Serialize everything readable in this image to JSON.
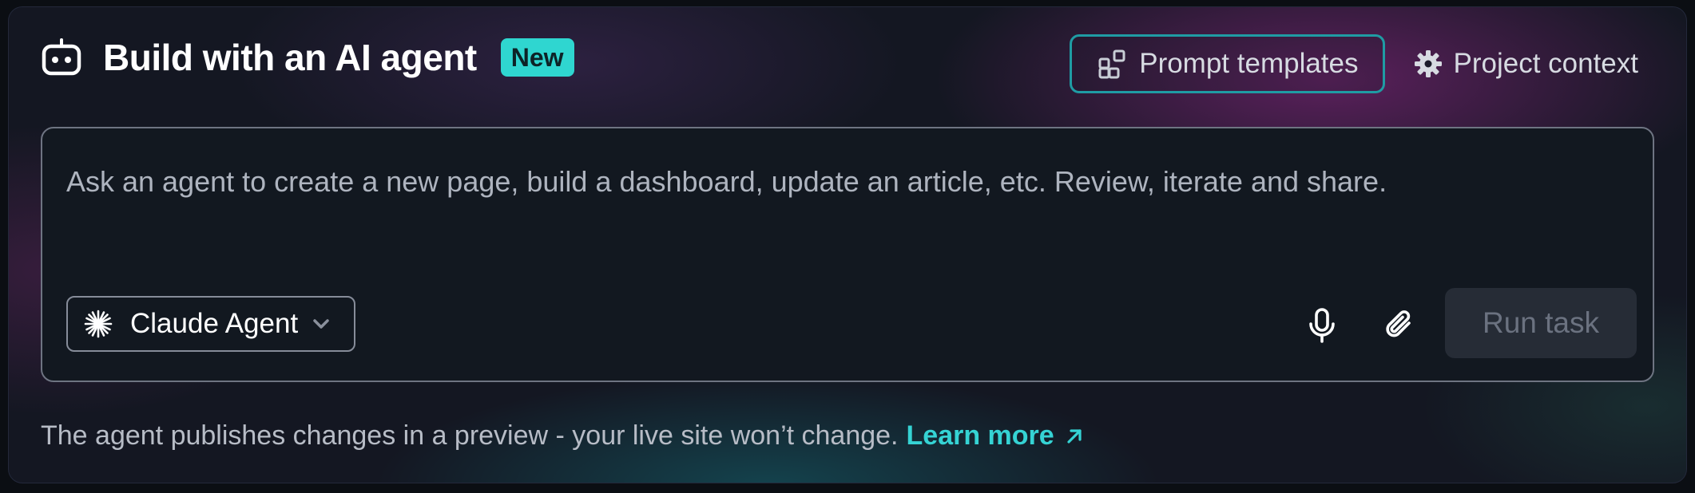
{
  "header": {
    "title": "Build with an AI agent",
    "badge": "New",
    "icon": "robot-icon"
  },
  "actions": {
    "templates_label": "Prompt templates",
    "templates_icon": "templates-icon",
    "context_label": "Project context",
    "context_icon": "gear-icon"
  },
  "prompt": {
    "placeholder": "Ask an agent to create a new page, build a dashboard, update an article, etc. Review, iterate and share.",
    "value": ""
  },
  "agent_selector": {
    "selected": "Claude Agent",
    "icon": "claude-spark-icon"
  },
  "toolbar": {
    "mic_icon": "microphone-icon",
    "attach_icon": "paperclip-icon",
    "run_label": "Run task"
  },
  "footer": {
    "note": "The agent publishes changes in a preview - your live site won’t change.",
    "learn_more": "Learn more"
  },
  "colors": {
    "accent": "#2fd6d0",
    "link": "#35d3d4",
    "template_border": "#1f9ca4",
    "run_bg": "#262c36",
    "run_text": "#6b7280"
  }
}
